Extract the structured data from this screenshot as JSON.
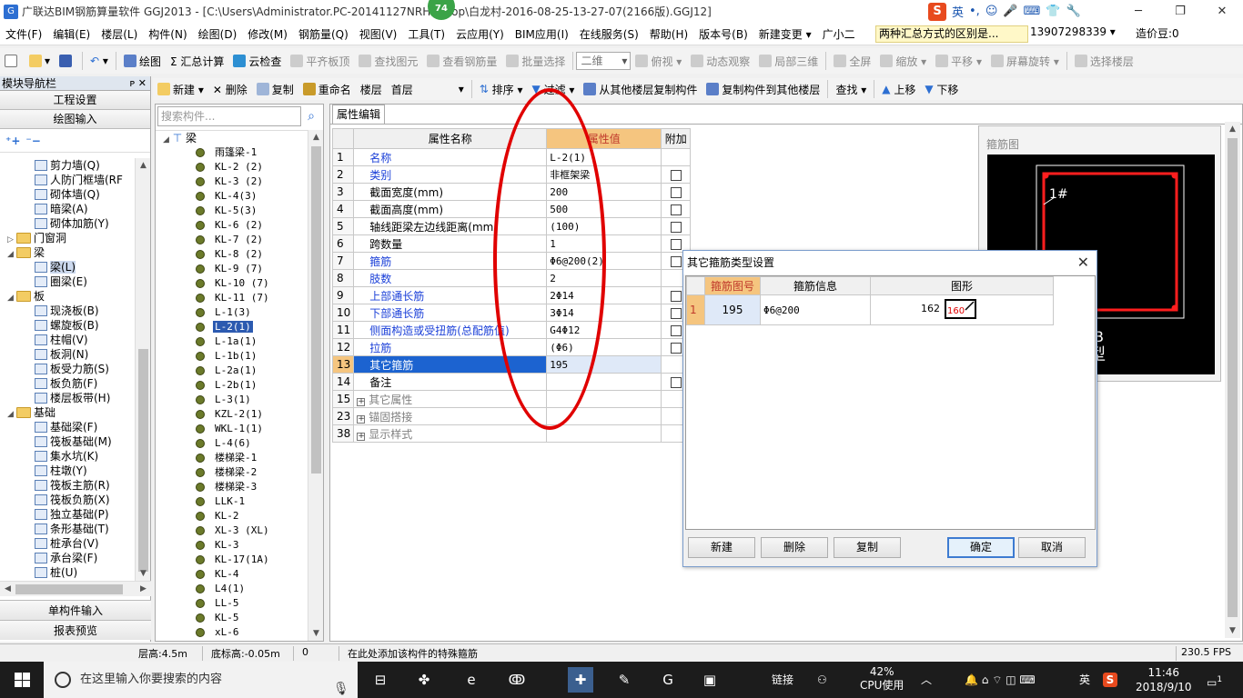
{
  "window": {
    "title": "广联达BIM钢筋算量软件 GGJ2013 - [C:\\Users\\Administrator.PC-20141127NRH...ktop\\白龙村-2016-08-25-13-27-07(2166版).GGJ12]",
    "badge": "74",
    "ime_label": "英",
    "controls": [
      "─",
      "❐",
      "✕"
    ]
  },
  "menu": {
    "items": [
      "文件(F)",
      "编辑(E)",
      "楼层(L)",
      "构件(N)",
      "绘图(D)",
      "修改(M)",
      "钢筋量(Q)",
      "视图(V)",
      "工具(T)",
      "云应用(Y)",
      "BIM应用(I)",
      "在线服务(S)",
      "帮助(H)",
      "版本号(B)",
      "新建变更 ▾",
      "广小二"
    ],
    "notice": "两种汇总方式的区别是...",
    "phone": "13907298339 ▾",
    "beans": "造价豆:0"
  },
  "toolbar1": {
    "items": [
      "绘图",
      "Σ 汇总计算",
      "云检查",
      "平齐板顶",
      "查找图元",
      "查看钢筋量",
      "批量选择"
    ],
    "view_combo": "二维",
    "right_items": [
      "俯视 ▾",
      "动态观察",
      "局部三维",
      "全屏",
      "缩放 ▾",
      "平移 ▾",
      "屏幕旋转 ▾",
      "选择楼层"
    ]
  },
  "leftnav": {
    "header": "模块导航栏",
    "pins": "ᴘ ✕",
    "buttons": [
      "工程设置",
      "绘图输入"
    ],
    "tree": [
      {
        "label": "剪力墙(Q)",
        "level": 2,
        "kind": "item"
      },
      {
        "label": "人防门框墙(RF",
        "level": 2,
        "kind": "item"
      },
      {
        "label": "砌体墙(Q)",
        "level": 2,
        "kind": "item"
      },
      {
        "label": "暗梁(A)",
        "level": 2,
        "kind": "item"
      },
      {
        "label": "砌体加筋(Y)",
        "level": 2,
        "kind": "item"
      },
      {
        "label": "门窗洞",
        "level": 1,
        "kind": "folder",
        "exp": "▷"
      },
      {
        "label": "梁",
        "level": 1,
        "kind": "folder",
        "exp": "◢"
      },
      {
        "label": "梁(L)",
        "level": 2,
        "kind": "item",
        "selected": true
      },
      {
        "label": "圈梁(E)",
        "level": 2,
        "kind": "item"
      },
      {
        "label": "板",
        "level": 1,
        "kind": "folder",
        "exp": "◢"
      },
      {
        "label": "现浇板(B)",
        "level": 2,
        "kind": "item"
      },
      {
        "label": "螺旋板(B)",
        "level": 2,
        "kind": "item"
      },
      {
        "label": "柱帽(V)",
        "level": 2,
        "kind": "item"
      },
      {
        "label": "板洞(N)",
        "level": 2,
        "kind": "item"
      },
      {
        "label": "板受力筋(S)",
        "level": 2,
        "kind": "item"
      },
      {
        "label": "板负筋(F)",
        "level": 2,
        "kind": "item"
      },
      {
        "label": "楼层板带(H)",
        "level": 2,
        "kind": "item"
      },
      {
        "label": "基础",
        "level": 1,
        "kind": "folder",
        "exp": "◢"
      },
      {
        "label": "基础梁(F)",
        "level": 2,
        "kind": "item"
      },
      {
        "label": "筏板基础(M)",
        "level": 2,
        "kind": "item"
      },
      {
        "label": "集水坑(K)",
        "level": 2,
        "kind": "item"
      },
      {
        "label": "柱墩(Y)",
        "level": 2,
        "kind": "item"
      },
      {
        "label": "筏板主筋(R)",
        "level": 2,
        "kind": "item"
      },
      {
        "label": "筏板负筋(X)",
        "level": 2,
        "kind": "item"
      },
      {
        "label": "独立基础(P)",
        "level": 2,
        "kind": "item"
      },
      {
        "label": "条形基础(T)",
        "level": 2,
        "kind": "item"
      },
      {
        "label": "桩承台(V)",
        "level": 2,
        "kind": "item"
      },
      {
        "label": "承台梁(F)",
        "level": 2,
        "kind": "item"
      },
      {
        "label": "桩(U)",
        "level": 2,
        "kind": "item"
      }
    ],
    "bottom_buttons": [
      "单构件输入",
      "报表预览"
    ]
  },
  "toolbar2": {
    "items": [
      "新建 ▾",
      "✕ 删除",
      "复制",
      "重命名"
    ],
    "floor_label": "楼层",
    "floor_value": "首层",
    "right_items": [
      "排序 ▾",
      "过滤 ▾",
      "从其他楼层复制构件",
      "复制构件到其他楼层",
      "查找 ▾",
      "上移",
      "下移"
    ]
  },
  "complist": {
    "search_placeholder": "搜索构件...",
    "root": "梁",
    "items": [
      "雨篷梁-1",
      "KL-2 (2)",
      "KL-3 (2)",
      "KL-4(3)",
      "KL-5(3)",
      "KL-6 (2)",
      "KL-7 (2)",
      "KL-8 (2)",
      "KL-9 (7)",
      "KL-10 (7)",
      "KL-11 (7)",
      "L-1(3)",
      "L-2(1)",
      "L-1a(1)",
      "L-1b(1)",
      "L-2a(1)",
      "L-2b(1)",
      "L-3(1)",
      "KZL-2(1)",
      "WKL-1(1)",
      "L-4(6)",
      "楼梯梁-1",
      "楼梯梁-2",
      "楼梯梁-3",
      "LLK-1",
      "KL-2",
      "XL-3 (XL)",
      "KL-3",
      "KL-17(1A)",
      "KL-4",
      "L4(1)",
      "LL-5",
      "KL-5",
      "xL-6"
    ],
    "selected_index": 12
  },
  "propeditor": {
    "tab": "属性编辑",
    "headers": [
      "属性名称",
      "属性值",
      "附加"
    ],
    "rows": [
      {
        "num": "1",
        "name": "名称",
        "value": "L-2(1)",
        "color": "blue",
        "check": false
      },
      {
        "num": "2",
        "name": "类别",
        "value": "非框架梁",
        "color": "blue",
        "check": true
      },
      {
        "num": "3",
        "name": "截面宽度(mm)",
        "value": "200",
        "color": "black",
        "check": true
      },
      {
        "num": "4",
        "name": "截面高度(mm)",
        "value": "500",
        "color": "black",
        "check": true
      },
      {
        "num": "5",
        "name": "轴线距梁左边线距离(mm)",
        "value": "(100)",
        "color": "black",
        "check": true
      },
      {
        "num": "6",
        "name": "跨数量",
        "value": "1",
        "color": "black",
        "check": true
      },
      {
        "num": "7",
        "name": "箍筋",
        "value": "Φ6@200(2)",
        "color": "blue",
        "check": true
      },
      {
        "num": "8",
        "name": "肢数",
        "value": "2",
        "color": "blue",
        "check": false
      },
      {
        "num": "9",
        "name": "上部通长筋",
        "value": "2Φ14",
        "color": "blue",
        "check": true
      },
      {
        "num": "10",
        "name": "下部通长筋",
        "value": "3Φ14",
        "color": "blue",
        "check": true
      },
      {
        "num": "11",
        "name": "侧面构造或受扭筋(总配筋值)",
        "value": "G4Φ12",
        "color": "blue",
        "check": true
      },
      {
        "num": "12",
        "name": "拉筋",
        "value": "(Φ6)",
        "color": "blue",
        "check": true
      },
      {
        "num": "13",
        "name": "其它箍筋",
        "value": "195",
        "color": "black",
        "check": false,
        "selected": true
      },
      {
        "num": "14",
        "name": "备注",
        "value": "",
        "color": "black",
        "check": true
      },
      {
        "num": "15",
        "name": "其它属性",
        "value": "",
        "color": "gray",
        "group": true
      },
      {
        "num": "23",
        "name": "锚固搭接",
        "value": "",
        "color": "gray",
        "group": true
      },
      {
        "num": "38",
        "name": "显示样式",
        "value": "",
        "color": "gray",
        "group": true
      }
    ]
  },
  "preview": {
    "caption": "箍筋图",
    "label_1": "1#",
    "label_b": "B",
    "label_type": "型"
  },
  "dialog": {
    "title": "其它箍筋类型设置",
    "headers": [
      "箍筋图号",
      "箍筋信息",
      "图形"
    ],
    "rows": [
      {
        "num": "1",
        "code": "195",
        "info": "Φ6@200",
        "len1": "162",
        "len2": "160"
      }
    ],
    "buttons": {
      "new": "新建",
      "delete": "删除",
      "copy": "复制",
      "ok": "确定",
      "cancel": "取消"
    }
  },
  "statusbar": {
    "floor_height": "层高:4.5m",
    "bottom_elev": "底标高:-0.05m",
    "zero": "0",
    "hint": "在此处添加该构件的特殊箍筋",
    "fps": "230.5 FPS"
  },
  "taskbar": {
    "search_placeholder": "在这里输入你要搜索的内容",
    "link": "链接",
    "cpu_pct": "42%",
    "cpu_label": "CPU使用",
    "lang": "英",
    "time": "11:46",
    "date": "2018/9/10",
    "notify_count": "1"
  },
  "colors": {
    "annotation": "#e00000",
    "header_accent": "#f5c57f",
    "selection": "#1c63d0",
    "rebar_red": "#ff1e1e"
  }
}
